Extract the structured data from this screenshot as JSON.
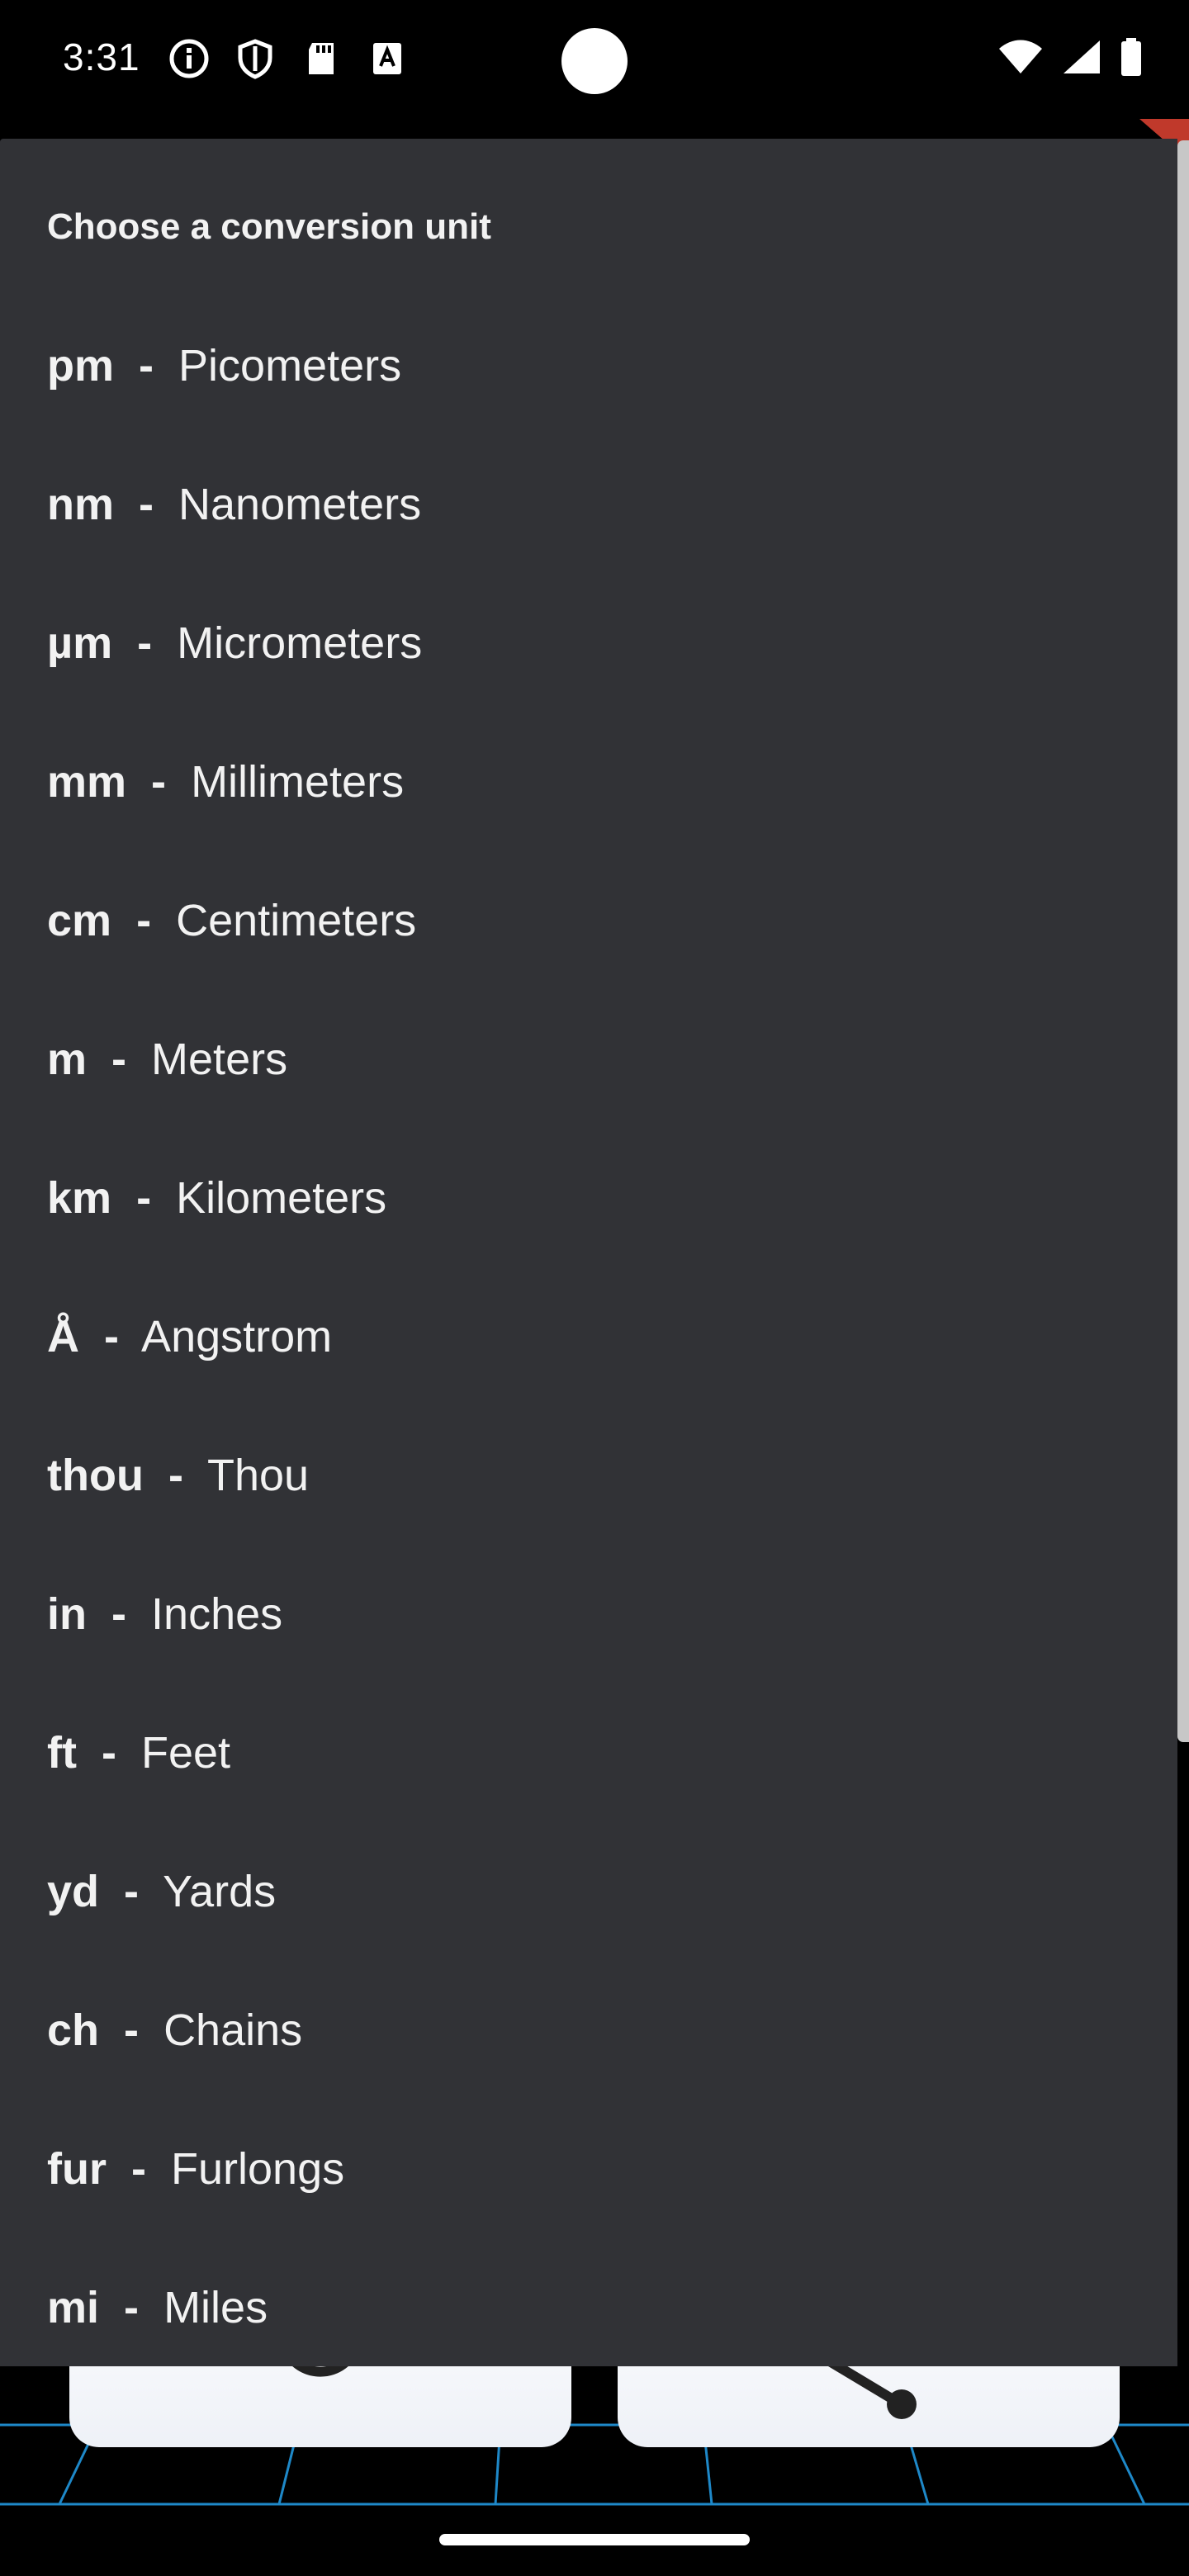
{
  "status_bar": {
    "time": "3:31",
    "left_icons": [
      "info-icon",
      "shield-icon",
      "sd-card-icon",
      "text-icon"
    ],
    "right_icons": [
      "wifi-icon",
      "signal-icon",
      "battery-icon"
    ]
  },
  "sheet": {
    "title": "Choose a conversion unit",
    "items": [
      {
        "abbr": "pm",
        "name": "Picometers"
      },
      {
        "abbr": "nm",
        "name": "Nanometers"
      },
      {
        "abbr": "µm",
        "name": "Micrometers"
      },
      {
        "abbr": "mm",
        "name": "Millimeters"
      },
      {
        "abbr": "cm",
        "name": "Centimeters"
      },
      {
        "abbr": "m",
        "name": "Meters"
      },
      {
        "abbr": "km",
        "name": "Kilometers"
      },
      {
        "abbr": "Å",
        "name": "Angstrom"
      },
      {
        "abbr": "thou",
        "name": "Thou"
      },
      {
        "abbr": "in",
        "name": "Inches"
      },
      {
        "abbr": "ft",
        "name": "Feet"
      },
      {
        "abbr": "yd",
        "name": "Yards"
      },
      {
        "abbr": "ch",
        "name": "Chains"
      },
      {
        "abbr": "fur",
        "name": "Furlongs"
      },
      {
        "abbr": "mi",
        "name": "Miles"
      }
    ],
    "separator": "-"
  },
  "background": {
    "left_button_icon": "refresh-icon",
    "right_button_icon": "share-icon"
  },
  "colors": {
    "sheet_bg": "#313236",
    "text": "#f2f2f2",
    "grid_line": "#1e88c8",
    "accent_flag": "#c0392b"
  }
}
